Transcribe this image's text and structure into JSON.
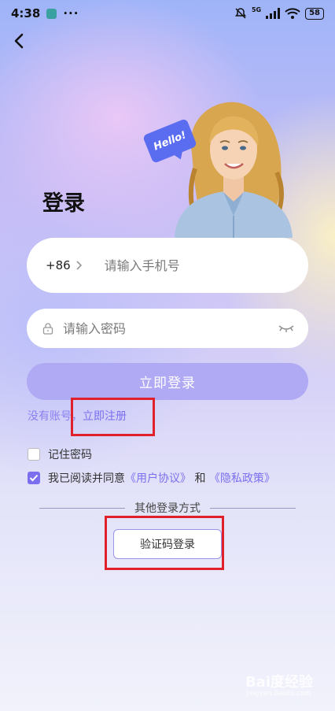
{
  "status_bar": {
    "time": "4:38",
    "dots": "···",
    "network": "5G",
    "battery": "58"
  },
  "hero": {
    "bubble_text": "Hello!"
  },
  "page": {
    "title": "登录"
  },
  "form": {
    "country_code": "+86",
    "phone_placeholder": "请输入手机号",
    "password_placeholder": "请输入密码",
    "login_button": "立即登录"
  },
  "register": {
    "prefix": "没有账号，",
    "link": "立即注册"
  },
  "options": {
    "remember_label": "记住密码",
    "remember_checked": false,
    "agree_prefix": "我已阅读并同意",
    "user_agreement": "《用户协议》",
    "and": " 和 ",
    "privacy_policy": "《隐私政策》",
    "agree_checked": true
  },
  "other_login": {
    "divider_text": "其他登录方式",
    "sms_button": "验证码登录"
  },
  "watermark": {
    "text": "Bai度经验",
    "sub": "jingyan.baidu.com"
  },
  "colors": {
    "accent": "#7b6fef",
    "button_bg": "#b0a9f3",
    "highlight": "#e0202a"
  }
}
